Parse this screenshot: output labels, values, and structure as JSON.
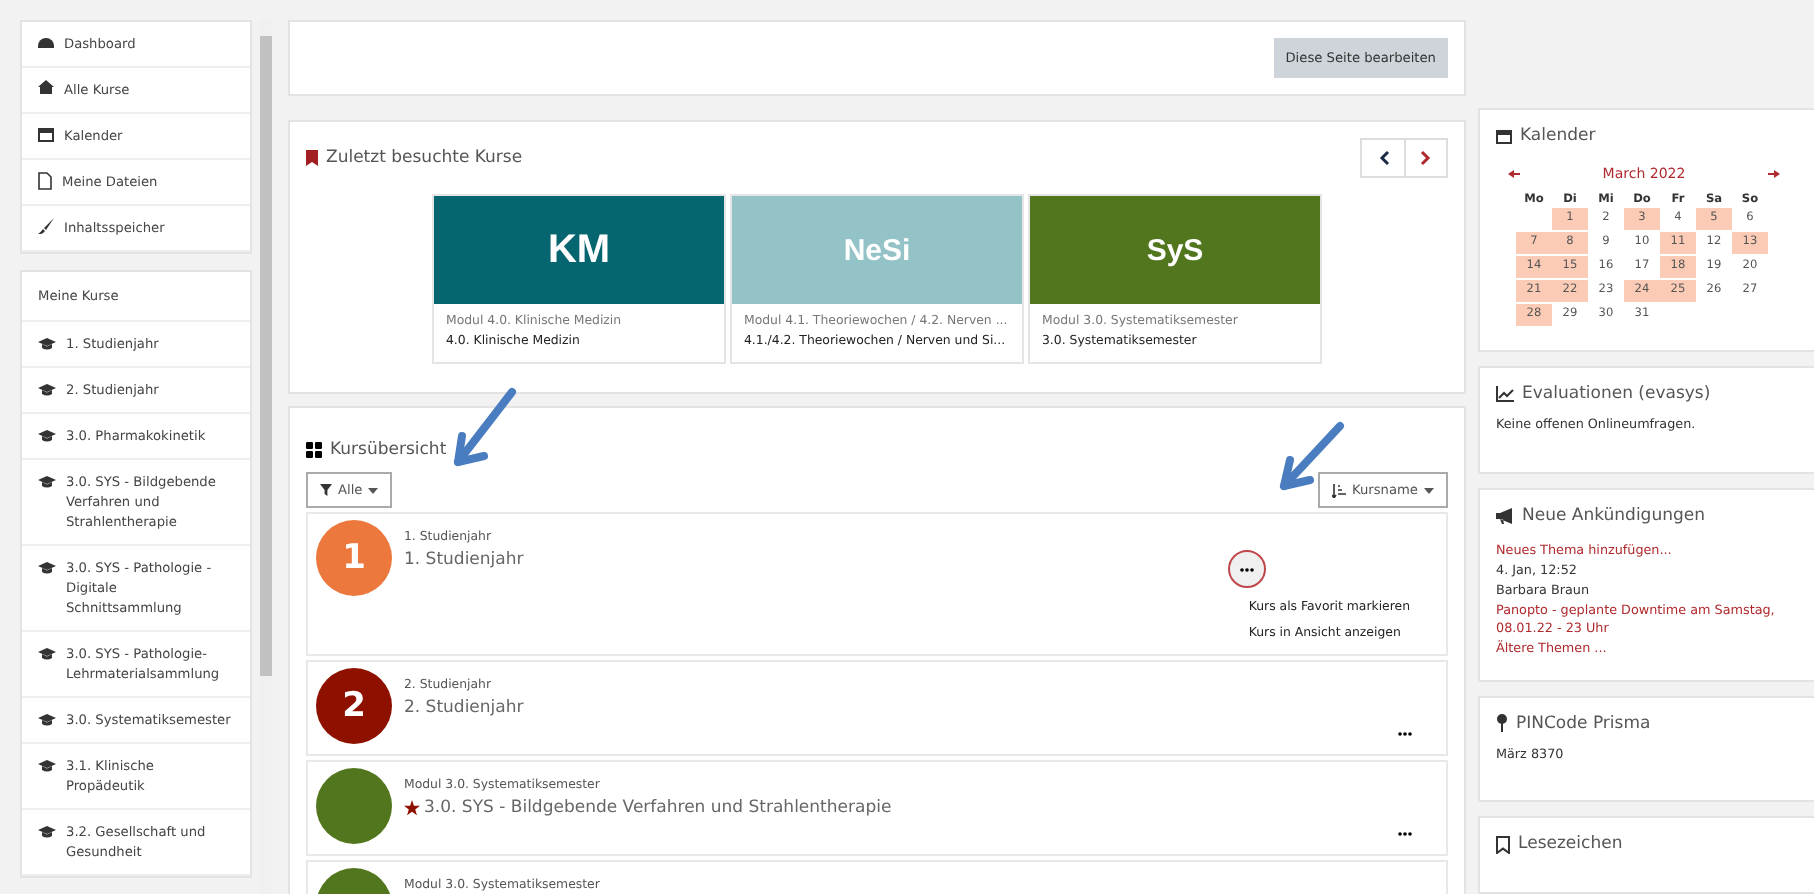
{
  "nav": {
    "items": [
      "Dashboard",
      "Alle Kurse",
      "Kalender",
      "Meine Dateien",
      "Inhaltsspeicher"
    ]
  },
  "my_courses": {
    "title": "Meine Kurse",
    "items": [
      "1. Studienjahr",
      "2. Studienjahr",
      "3.0. Pharmakokinetik",
      "3.0. SYS - Bildgebende Verfahren und Strahlentherapie",
      "3.0. SYS - Pathologie - Digitale Schnittsammlung",
      "3.0. SYS - Pathologie-Lehrmaterialsammlung",
      "3.0. Systematiksemester",
      "3.1. Klinische Propädeutik",
      "3.2. Gesellschaft und Gesundheit"
    ]
  },
  "edit_button": "Diese Seite bearbeiten",
  "recent": {
    "title": "Zuletzt besuchte Kurse",
    "cards": [
      {
        "image_text": "KM",
        "color": "#06666f",
        "category": "Modul 4.0. Klinische Medizin",
        "name": "4.0. Klinische Medizin"
      },
      {
        "image_text": "NeSi",
        "color": "#94c3c7",
        "category": "Modul 4.1. Theoriewochen / 4.2. Nerven ...",
        "name": "4.1./4.2. Theoriewochen / Nerven und Si..."
      },
      {
        "image_text": "SyS",
        "color": "#52761d",
        "category": "Modul 3.0. Systematiksemester",
        "name": "3.0. Systematiksemester"
      }
    ]
  },
  "overview": {
    "title": "Kursübersicht",
    "filter": "Alle",
    "sort": "Kursname",
    "courses": [
      {
        "badge": "1",
        "color": "#ed783d",
        "category": "1. Studienjahr",
        "name": "1. Studienjahr",
        "starred": false,
        "menu_open": true,
        "menu": [
          "Kurs als Favorit markieren",
          "Kurs in Ansicht anzeigen"
        ]
      },
      {
        "badge": "2",
        "color": "#8e1100",
        "category": "2. Studienjahr",
        "name": "2. Studienjahr",
        "starred": false,
        "menu_open": false
      },
      {
        "color": "#52761d",
        "category": "Modul 3.0. Systematiksemester",
        "name": "3.0. SYS - Bildgebende Verfahren und Strahlentherapie",
        "starred": true,
        "menu_open": false
      },
      {
        "color": "#52761d",
        "category": "Modul 3.0. Systematiksemester"
      }
    ]
  },
  "calendar": {
    "title": "Kalender",
    "month": "March 2022",
    "weekdays": [
      "Mo",
      "Di",
      "Mi",
      "Do",
      "Fr",
      "Sa",
      "So"
    ],
    "weeks": [
      [
        {
          "day": "1",
          "event": true
        },
        {
          "day": "2",
          "event": false
        },
        {
          "day": "3",
          "event": true
        },
        {
          "day": "4",
          "event": false
        },
        {
          "day": "5",
          "event": true
        },
        {
          "day": "6",
          "event": false
        }
      ],
      [
        {
          "day": "7",
          "event": true
        },
        {
          "day": "8",
          "event": true
        },
        {
          "day": "9",
          "event": false
        },
        {
          "day": "10",
          "event": false
        },
        {
          "day": "11",
          "event": true
        },
        {
          "day": "12",
          "event": false
        },
        {
          "day": "13",
          "event": true
        }
      ],
      [
        {
          "day": "14",
          "event": true
        },
        {
          "day": "15",
          "event": true
        },
        {
          "day": "16",
          "event": false
        },
        {
          "day": "17",
          "event": false
        },
        {
          "day": "18",
          "event": true
        },
        {
          "day": "19",
          "event": false
        },
        {
          "day": "20",
          "event": false
        }
      ],
      [
        {
          "day": "21",
          "event": true
        },
        {
          "day": "22",
          "event": true
        },
        {
          "day": "23",
          "event": false
        },
        {
          "day": "24",
          "event": true
        },
        {
          "day": "25",
          "event": true
        },
        {
          "day": "26",
          "event": false
        },
        {
          "day": "27",
          "event": false
        }
      ],
      [
        {
          "day": "28",
          "event": true
        },
        {
          "day": "29",
          "event": false
        },
        {
          "day": "30",
          "event": false
        },
        {
          "day": "31",
          "event": false
        }
      ]
    ]
  },
  "evaluations": {
    "title": "Evaluationen (evasys)",
    "text": "Keine offenen Onlineumfragen."
  },
  "news": {
    "title": "Neue Ankündigungen",
    "lines": [
      {
        "text": "Neues Thema hinzufügen...",
        "kind": "link"
      },
      {
        "text": "4. Jan, 12:52",
        "kind": "text"
      },
      {
        "text": "Barbara Braun",
        "kind": "text"
      },
      {
        "text": "Panopto - geplante Downtime am Samstag, 08.01.22 - 23 Uhr",
        "kind": "link"
      },
      {
        "text": "Ältere Themen ...",
        "kind": "link"
      }
    ]
  },
  "pincode": {
    "title": "PINCode Prisma",
    "text": "März 8370"
  },
  "bookmarks": {
    "title": "Lesezeichen"
  }
}
